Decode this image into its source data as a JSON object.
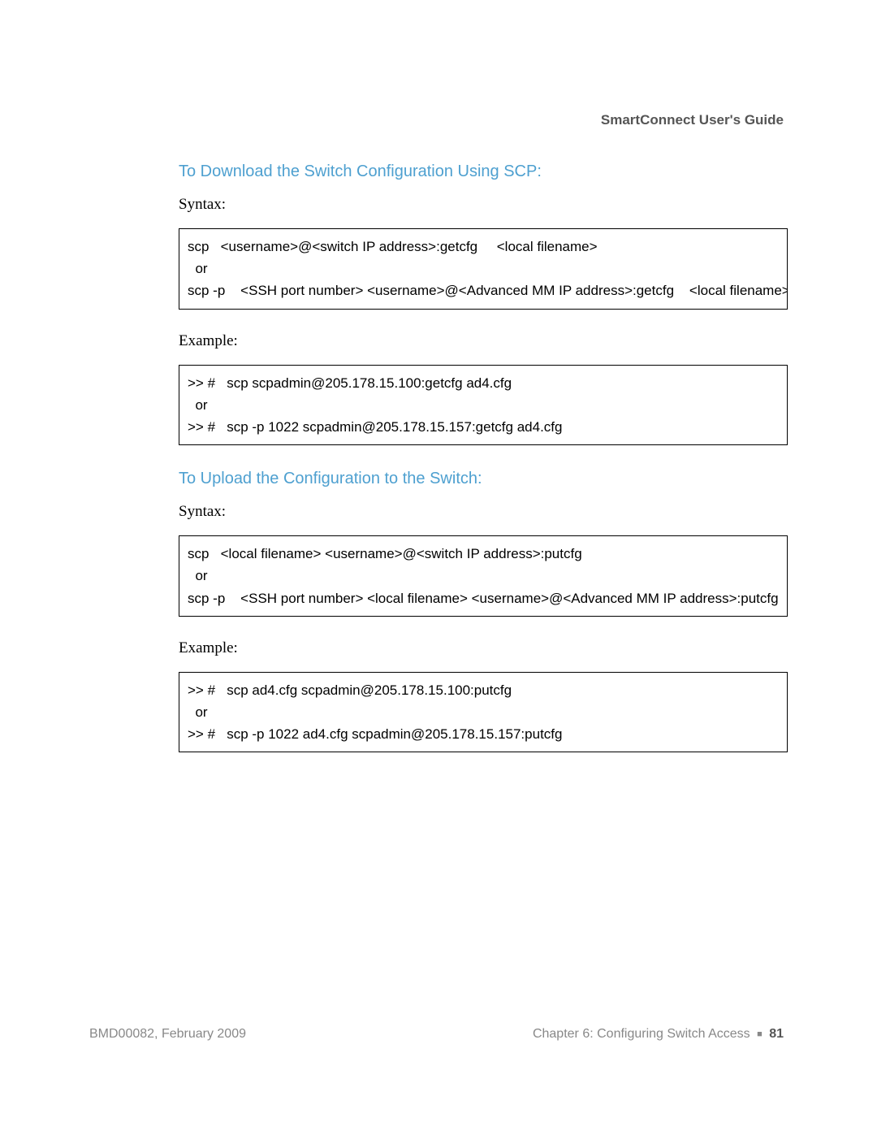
{
  "header": {
    "guide_title": "SmartConnect User's Guide"
  },
  "sections": [
    {
      "heading": "To Download the Switch Configuration Using SCP:",
      "syntax_label": "Syntax:",
      "syntax_box": "scp   <username>@<switch IP address>:getcfg     <local filename>\n  or\nscp -p    <SSH port number> <username>@<Advanced MM IP address>:getcfg    <local filename>",
      "example_label": "Example:",
      "example_box": ">> #   scp scpadmin@205.178.15.100:getcfg ad4.cfg\n  or\n>> #   scp -p 1022 scpadmin@205.178.15.157:getcfg ad4.cfg"
    },
    {
      "heading": "To Upload the Configuration to the Switch:",
      "syntax_label": "Syntax:",
      "syntax_box": "scp   <local filename> <username>@<switch IP address>:putcfg\n  or\nscp -p    <SSH port number> <local filename> <username>@<Advanced MM IP address>:putcfg",
      "example_label": "Example:",
      "example_box": ">> #   scp ad4.cfg scpadmin@205.178.15.100:putcfg\n  or\n>> #   scp -p 1022 ad4.cfg scpadmin@205.178.15.157:putcfg"
    }
  ],
  "footer": {
    "left": "BMD00082, February 2009",
    "right_chapter": "Chapter 6: Configuring Switch Access",
    "page_num": "81"
  }
}
